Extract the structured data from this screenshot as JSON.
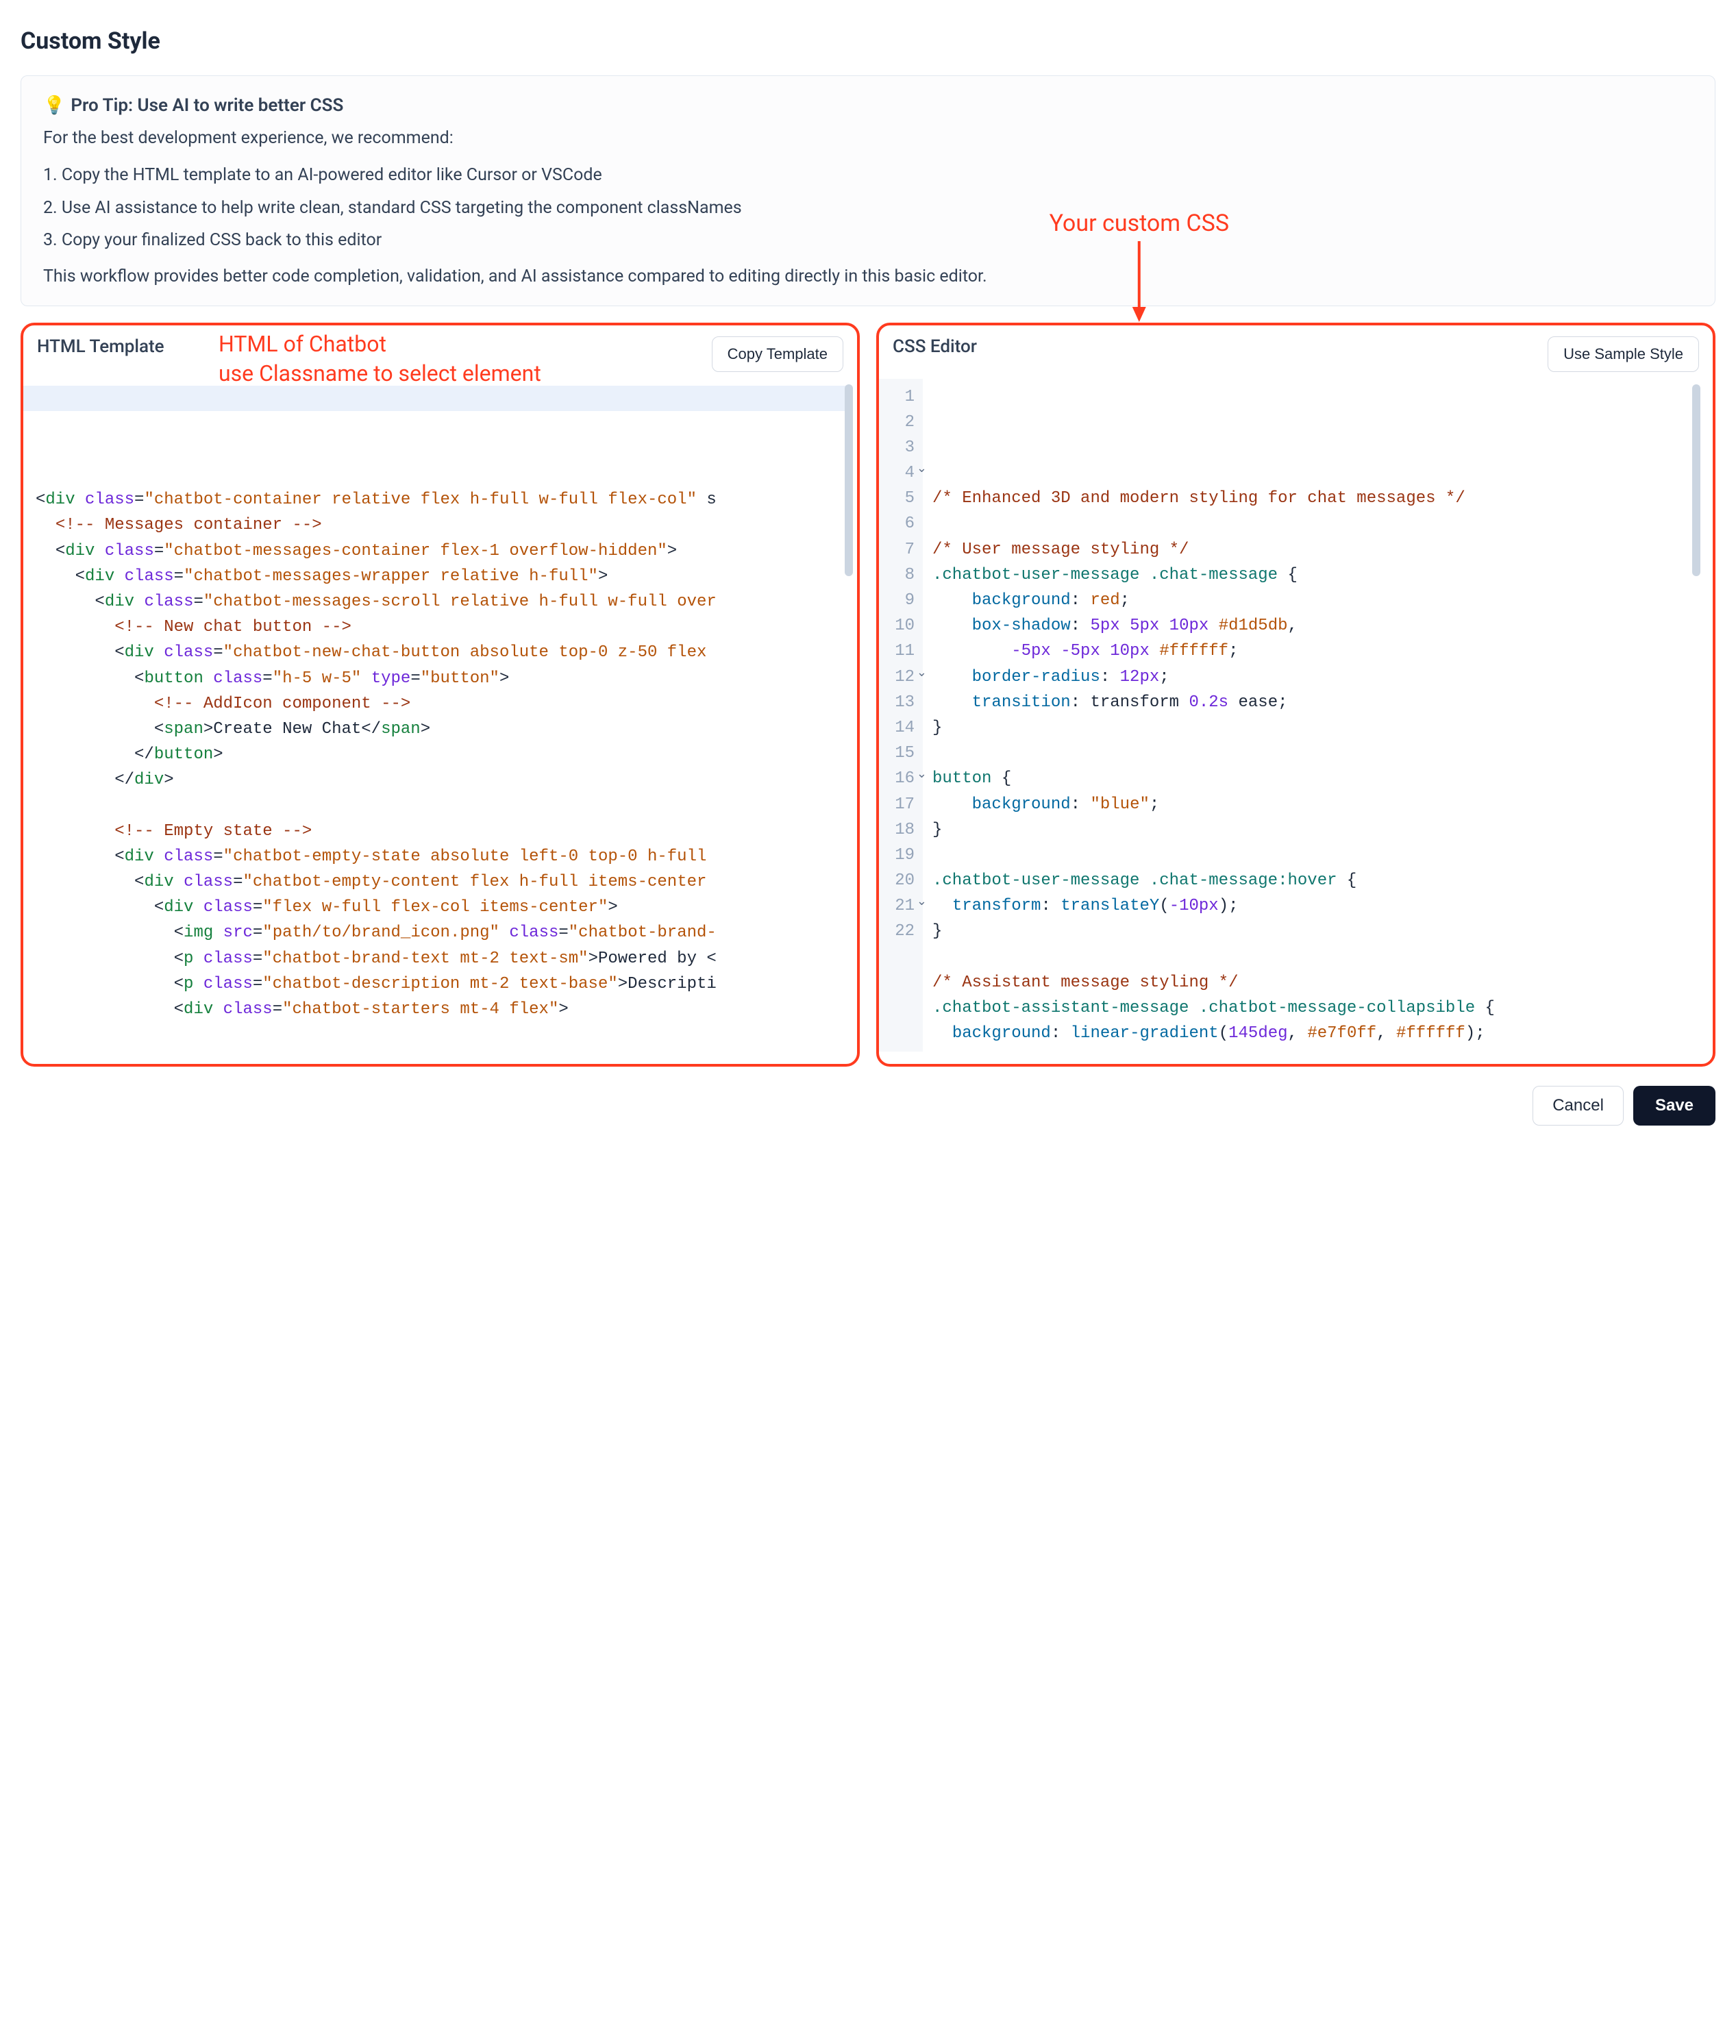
{
  "title": "Custom Style",
  "tip": {
    "icon": "💡",
    "heading": "Pro Tip: Use AI to write better CSS",
    "intro": "For the best development experience, we recommend:",
    "steps": [
      "1. Copy the HTML template to an AI-powered editor like Cursor or VSCode",
      "2. Use AI assistance to help write clean, standard CSS targeting the component classNames",
      "3. Copy your finalized CSS back to this editor"
    ],
    "footer": "This workflow provides better code completion, validation, and AI assistance compared to editing directly in this basic editor."
  },
  "annotations": {
    "left_line1": "HTML of Chatbot",
    "left_line2": "use Classname to select element",
    "right": "Your custom CSS"
  },
  "html_panel": {
    "label": "HTML Template",
    "button": "Copy Template",
    "code_lines": [
      {
        "indent": 0,
        "parts": [
          {
            "c": "t-txt",
            "t": "<"
          },
          {
            "c": "t-tag",
            "t": "div"
          },
          {
            "c": "t-txt",
            "t": " "
          },
          {
            "c": "t-attr",
            "t": "class"
          },
          {
            "c": "t-txt",
            "t": "="
          },
          {
            "c": "t-str",
            "t": "\"chatbot-container relative flex h-full w-full flex-col\""
          },
          {
            "c": "t-txt",
            "t": " s"
          }
        ]
      },
      {
        "indent": 1,
        "parts": [
          {
            "c": "t-cmt",
            "t": "<!-- Messages container -->"
          }
        ]
      },
      {
        "indent": 1,
        "parts": [
          {
            "c": "t-txt",
            "t": "<"
          },
          {
            "c": "t-tag",
            "t": "div"
          },
          {
            "c": "t-txt",
            "t": " "
          },
          {
            "c": "t-attr",
            "t": "class"
          },
          {
            "c": "t-txt",
            "t": "="
          },
          {
            "c": "t-str",
            "t": "\"chatbot-messages-container flex-1 overflow-hidden\""
          },
          {
            "c": "t-txt",
            "t": ">"
          }
        ]
      },
      {
        "indent": 2,
        "parts": [
          {
            "c": "t-txt",
            "t": "<"
          },
          {
            "c": "t-tag",
            "t": "div"
          },
          {
            "c": "t-txt",
            "t": " "
          },
          {
            "c": "t-attr",
            "t": "class"
          },
          {
            "c": "t-txt",
            "t": "="
          },
          {
            "c": "t-str",
            "t": "\"chatbot-messages-wrapper relative h-full\""
          },
          {
            "c": "t-txt",
            "t": ">"
          }
        ]
      },
      {
        "indent": 3,
        "parts": [
          {
            "c": "t-txt",
            "t": "<"
          },
          {
            "c": "t-tag",
            "t": "div"
          },
          {
            "c": "t-txt",
            "t": " "
          },
          {
            "c": "t-attr",
            "t": "class"
          },
          {
            "c": "t-txt",
            "t": "="
          },
          {
            "c": "t-str",
            "t": "\"chatbot-messages-scroll relative h-full w-full over"
          }
        ]
      },
      {
        "indent": 4,
        "parts": [
          {
            "c": "t-cmt",
            "t": "<!-- New chat button -->"
          }
        ]
      },
      {
        "indent": 4,
        "parts": [
          {
            "c": "t-txt",
            "t": "<"
          },
          {
            "c": "t-tag",
            "t": "div"
          },
          {
            "c": "t-txt",
            "t": " "
          },
          {
            "c": "t-attr",
            "t": "class"
          },
          {
            "c": "t-txt",
            "t": "="
          },
          {
            "c": "t-str",
            "t": "\"chatbot-new-chat-button absolute top-0 z-50 flex"
          }
        ]
      },
      {
        "indent": 5,
        "parts": [
          {
            "c": "t-txt",
            "t": "<"
          },
          {
            "c": "t-tag",
            "t": "button"
          },
          {
            "c": "t-txt",
            "t": " "
          },
          {
            "c": "t-attr",
            "t": "class"
          },
          {
            "c": "t-txt",
            "t": "="
          },
          {
            "c": "t-str",
            "t": "\"h-5 w-5\""
          },
          {
            "c": "t-txt",
            "t": " "
          },
          {
            "c": "t-attr",
            "t": "type"
          },
          {
            "c": "t-txt",
            "t": "="
          },
          {
            "c": "t-str",
            "t": "\"button\""
          },
          {
            "c": "t-txt",
            "t": ">"
          }
        ]
      },
      {
        "indent": 6,
        "parts": [
          {
            "c": "t-cmt",
            "t": "<!-- AddIcon component -->"
          }
        ]
      },
      {
        "indent": 6,
        "parts": [
          {
            "c": "t-txt",
            "t": "<"
          },
          {
            "c": "t-tag",
            "t": "span"
          },
          {
            "c": "t-txt",
            "t": ">Create New Chat</"
          },
          {
            "c": "t-tag",
            "t": "span"
          },
          {
            "c": "t-txt",
            "t": ">"
          }
        ]
      },
      {
        "indent": 5,
        "parts": [
          {
            "c": "t-txt",
            "t": "</"
          },
          {
            "c": "t-tag",
            "t": "button"
          },
          {
            "c": "t-txt",
            "t": ">"
          }
        ]
      },
      {
        "indent": 4,
        "parts": [
          {
            "c": "t-txt",
            "t": "</"
          },
          {
            "c": "t-tag",
            "t": "div"
          },
          {
            "c": "t-txt",
            "t": ">"
          }
        ]
      },
      {
        "indent": 0,
        "parts": [
          {
            "c": "t-txt",
            "t": " "
          }
        ]
      },
      {
        "indent": 4,
        "parts": [
          {
            "c": "t-cmt",
            "t": "<!-- Empty state -->"
          }
        ]
      },
      {
        "indent": 4,
        "parts": [
          {
            "c": "t-txt",
            "t": "<"
          },
          {
            "c": "t-tag",
            "t": "div"
          },
          {
            "c": "t-txt",
            "t": " "
          },
          {
            "c": "t-attr",
            "t": "class"
          },
          {
            "c": "t-txt",
            "t": "="
          },
          {
            "c": "t-str",
            "t": "\"chatbot-empty-state absolute left-0 top-0 h-full"
          }
        ]
      },
      {
        "indent": 5,
        "parts": [
          {
            "c": "t-txt",
            "t": "<"
          },
          {
            "c": "t-tag",
            "t": "div"
          },
          {
            "c": "t-txt",
            "t": " "
          },
          {
            "c": "t-attr",
            "t": "class"
          },
          {
            "c": "t-txt",
            "t": "="
          },
          {
            "c": "t-str",
            "t": "\"chatbot-empty-content flex h-full items-center"
          }
        ]
      },
      {
        "indent": 6,
        "parts": [
          {
            "c": "t-txt",
            "t": "<"
          },
          {
            "c": "t-tag",
            "t": "div"
          },
          {
            "c": "t-txt",
            "t": " "
          },
          {
            "c": "t-attr",
            "t": "class"
          },
          {
            "c": "t-txt",
            "t": "="
          },
          {
            "c": "t-str",
            "t": "\"flex w-full flex-col items-center\""
          },
          {
            "c": "t-txt",
            "t": ">"
          }
        ]
      },
      {
        "indent": 7,
        "parts": [
          {
            "c": "t-txt",
            "t": "<"
          },
          {
            "c": "t-tag",
            "t": "img"
          },
          {
            "c": "t-txt",
            "t": " "
          },
          {
            "c": "t-attr",
            "t": "src"
          },
          {
            "c": "t-txt",
            "t": "="
          },
          {
            "c": "t-str",
            "t": "\"path/to/brand_icon.png\""
          },
          {
            "c": "t-txt",
            "t": " "
          },
          {
            "c": "t-attr",
            "t": "class"
          },
          {
            "c": "t-txt",
            "t": "="
          },
          {
            "c": "t-str",
            "t": "\"chatbot-brand-"
          }
        ]
      },
      {
        "indent": 7,
        "parts": [
          {
            "c": "t-txt",
            "t": "<"
          },
          {
            "c": "t-tag",
            "t": "p"
          },
          {
            "c": "t-txt",
            "t": " "
          },
          {
            "c": "t-attr",
            "t": "class"
          },
          {
            "c": "t-txt",
            "t": "="
          },
          {
            "c": "t-str",
            "t": "\"chatbot-brand-text mt-2 text-sm\""
          },
          {
            "c": "t-txt",
            "t": ">Powered by <"
          }
        ]
      },
      {
        "indent": 7,
        "parts": [
          {
            "c": "t-txt",
            "t": "<"
          },
          {
            "c": "t-tag",
            "t": "p"
          },
          {
            "c": "t-txt",
            "t": " "
          },
          {
            "c": "t-attr",
            "t": "class"
          },
          {
            "c": "t-txt",
            "t": "="
          },
          {
            "c": "t-str",
            "t": "\"chatbot-description mt-2 text-base\""
          },
          {
            "c": "t-txt",
            "t": ">Descripti"
          }
        ]
      },
      {
        "indent": 7,
        "parts": [
          {
            "c": "t-txt",
            "t": "<"
          },
          {
            "c": "t-tag",
            "t": "div"
          },
          {
            "c": "t-txt",
            "t": " "
          },
          {
            "c": "t-attr",
            "t": "class"
          },
          {
            "c": "t-txt",
            "t": "="
          },
          {
            "c": "t-str",
            "t": "\"chatbot-starters mt-4 flex\""
          },
          {
            "c": "t-txt",
            "t": ">"
          }
        ]
      }
    ]
  },
  "css_panel": {
    "label": "CSS Editor",
    "button": "Use Sample Style",
    "lines": [
      {
        "n": 1,
        "fold": false,
        "parts": [
          {
            "c": "c-cmt",
            "t": "/* Enhanced 3D and modern styling for chat messages */"
          }
        ]
      },
      {
        "n": 2,
        "fold": false,
        "parts": [
          {
            "c": "c-punc",
            "t": " "
          }
        ]
      },
      {
        "n": 3,
        "fold": false,
        "parts": [
          {
            "c": "c-cmt",
            "t": "/* User message styling */"
          }
        ]
      },
      {
        "n": 4,
        "fold": true,
        "parts": [
          {
            "c": "c-sel",
            "t": ".chatbot-user-message .chat-message"
          },
          {
            "c": "c-punc",
            "t": " {"
          }
        ]
      },
      {
        "n": 5,
        "fold": false,
        "parts": [
          {
            "c": "c-punc",
            "t": "    "
          },
          {
            "c": "c-prop",
            "t": "background"
          },
          {
            "c": "c-punc",
            "t": ": "
          },
          {
            "c": "c-kw",
            "t": "red"
          },
          {
            "c": "c-punc",
            "t": ";"
          }
        ]
      },
      {
        "n": 6,
        "fold": false,
        "parts": [
          {
            "c": "c-punc",
            "t": "    "
          },
          {
            "c": "c-prop",
            "t": "box-shadow"
          },
          {
            "c": "c-punc",
            "t": ": "
          },
          {
            "c": "c-num",
            "t": "5px 5px 10px"
          },
          {
            "c": "c-punc",
            "t": " "
          },
          {
            "c": "c-col",
            "t": "#d1d5db"
          },
          {
            "c": "c-punc",
            "t": ","
          }
        ]
      },
      {
        "n": 7,
        "fold": false,
        "parts": [
          {
            "c": "c-punc",
            "t": "        "
          },
          {
            "c": "c-num",
            "t": "-5px -5px 10px"
          },
          {
            "c": "c-punc",
            "t": " "
          },
          {
            "c": "c-col",
            "t": "#ffffff"
          },
          {
            "c": "c-punc",
            "t": ";"
          }
        ]
      },
      {
        "n": 8,
        "fold": false,
        "parts": [
          {
            "c": "c-punc",
            "t": "    "
          },
          {
            "c": "c-prop",
            "t": "border-radius"
          },
          {
            "c": "c-punc",
            "t": ": "
          },
          {
            "c": "c-num",
            "t": "12px"
          },
          {
            "c": "c-punc",
            "t": ";"
          }
        ]
      },
      {
        "n": 9,
        "fold": false,
        "parts": [
          {
            "c": "c-punc",
            "t": "    "
          },
          {
            "c": "c-prop",
            "t": "transition"
          },
          {
            "c": "c-punc",
            "t": ": transform "
          },
          {
            "c": "c-num",
            "t": "0.2s"
          },
          {
            "c": "c-punc",
            "t": " ease;"
          }
        ]
      },
      {
        "n": 10,
        "fold": false,
        "parts": [
          {
            "c": "c-punc",
            "t": "}"
          }
        ]
      },
      {
        "n": 11,
        "fold": false,
        "parts": [
          {
            "c": "c-punc",
            "t": " "
          }
        ]
      },
      {
        "n": 12,
        "fold": true,
        "parts": [
          {
            "c": "c-sel",
            "t": "button"
          },
          {
            "c": "c-punc",
            "t": " {"
          }
        ]
      },
      {
        "n": 13,
        "fold": false,
        "parts": [
          {
            "c": "c-punc",
            "t": "    "
          },
          {
            "c": "c-prop",
            "t": "background"
          },
          {
            "c": "c-punc",
            "t": ": "
          },
          {
            "c": "c-col",
            "t": "\"blue\""
          },
          {
            "c": "c-punc",
            "t": ";"
          }
        ]
      },
      {
        "n": 14,
        "fold": false,
        "parts": [
          {
            "c": "c-punc",
            "t": "}"
          }
        ]
      },
      {
        "n": 15,
        "fold": false,
        "parts": [
          {
            "c": "c-punc",
            "t": " "
          }
        ]
      },
      {
        "n": 16,
        "fold": true,
        "parts": [
          {
            "c": "c-sel",
            "t": ".chatbot-user-message .chat-message:hover"
          },
          {
            "c": "c-punc",
            "t": " {"
          }
        ]
      },
      {
        "n": 17,
        "fold": false,
        "parts": [
          {
            "c": "c-punc",
            "t": "  "
          },
          {
            "c": "c-prop",
            "t": "transform"
          },
          {
            "c": "c-punc",
            "t": ": "
          },
          {
            "c": "c-fn",
            "t": "translateY"
          },
          {
            "c": "c-punc",
            "t": "("
          },
          {
            "c": "c-num",
            "t": "-10px"
          },
          {
            "c": "c-punc",
            "t": ");"
          }
        ]
      },
      {
        "n": 18,
        "fold": false,
        "parts": [
          {
            "c": "c-punc",
            "t": "}"
          }
        ]
      },
      {
        "n": 19,
        "fold": false,
        "parts": [
          {
            "c": "c-punc",
            "t": " "
          }
        ]
      },
      {
        "n": 20,
        "fold": false,
        "parts": [
          {
            "c": "c-cmt",
            "t": "/* Assistant message styling */"
          }
        ]
      },
      {
        "n": 21,
        "fold": true,
        "parts": [
          {
            "c": "c-sel",
            "t": ".chatbot-assistant-message .chatbot-message-collapsible"
          },
          {
            "c": "c-punc",
            "t": " {"
          }
        ]
      },
      {
        "n": 22,
        "fold": false,
        "parts": [
          {
            "c": "c-punc",
            "t": "  "
          },
          {
            "c": "c-prop",
            "t": "background"
          },
          {
            "c": "c-punc",
            "t": ": "
          },
          {
            "c": "c-fn",
            "t": "linear-gradient"
          },
          {
            "c": "c-punc",
            "t": "("
          },
          {
            "c": "c-num",
            "t": "145deg"
          },
          {
            "c": "c-punc",
            "t": ", "
          },
          {
            "c": "c-col",
            "t": "#e7f0ff"
          },
          {
            "c": "c-punc",
            "t": ", "
          },
          {
            "c": "c-col",
            "t": "#ffffff"
          },
          {
            "c": "c-punc",
            "t": ");"
          }
        ]
      }
    ]
  },
  "actions": {
    "cancel": "Cancel",
    "save": "Save"
  }
}
